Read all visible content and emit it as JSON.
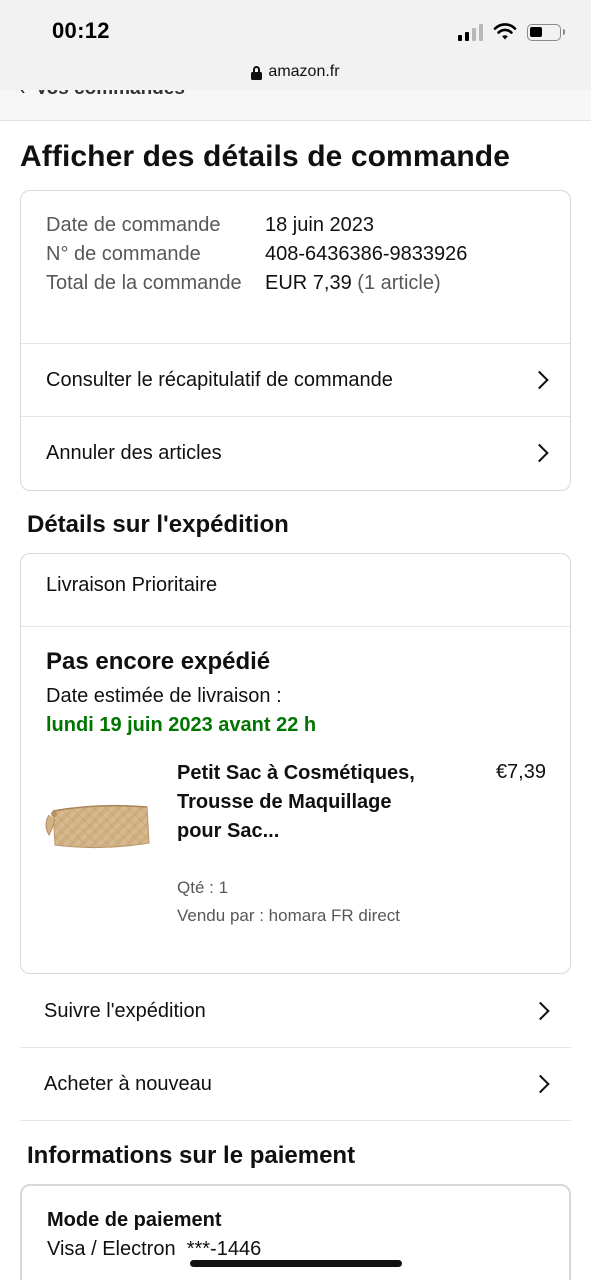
{
  "status_bar": {
    "time": "00:12",
    "icons": [
      "cellular-signal-icon",
      "wifi-icon",
      "battery-icon"
    ]
  },
  "browser": {
    "url": "amazon.fr"
  },
  "nav": {
    "back_label": "Vos commandes"
  },
  "page_title": "Afficher des détails de commande",
  "order_summary": {
    "rows": [
      {
        "label": "Date de commande",
        "value": "18 juin 2023",
        "extra": ""
      },
      {
        "label": "N° de commande",
        "value": "408-6436386-9833926",
        "extra": ""
      },
      {
        "label": "Total de la commande",
        "value": "EUR 7,39",
        "extra": "(1 article)"
      }
    ],
    "links": [
      {
        "label": "Consulter le récapitulatif de commande"
      },
      {
        "label": "Annuler des articles"
      }
    ]
  },
  "shipment": {
    "section_title": "Détails sur l'expédition",
    "shipping_type": "Livraison Prioritaire",
    "status": "Pas encore expédié",
    "estimated_label": "Date estimée de livraison :",
    "estimated_date": "lundi 19 juin 2023 avant 22 h",
    "product": {
      "title": "Petit Sac à Cosmétiques, Trousse de Maquillage pour Sac...",
      "price": "€7,39",
      "quantity": "Qté : 1",
      "seller": "Vendu par : homara FR direct"
    },
    "actions": [
      {
        "label": "Suivre l'expédition"
      },
      {
        "label": "Acheter à nouveau"
      }
    ]
  },
  "payment": {
    "section_title": "Informations sur le paiement",
    "method_label": "Mode de paiement",
    "method_value": "Visa / Electron  ***-1446"
  },
  "colors": {
    "delivery_green": "#007600",
    "border": "#d5d9d9",
    "muted_text": "#565959"
  }
}
